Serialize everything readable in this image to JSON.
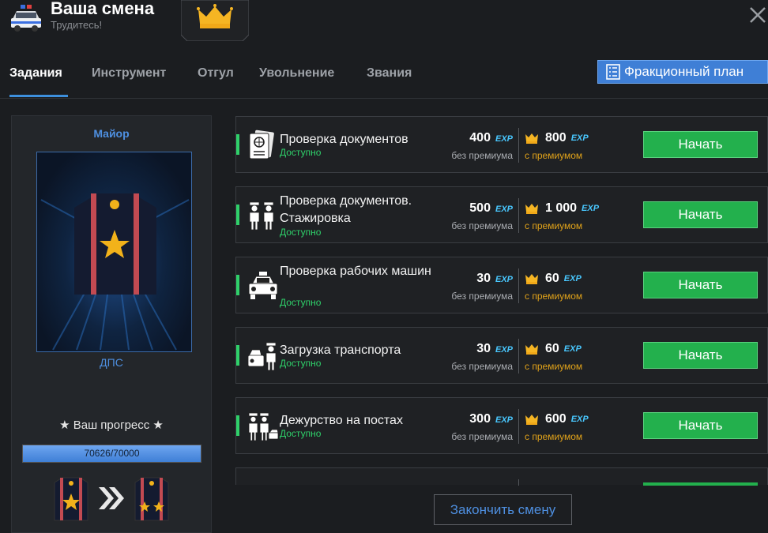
{
  "header": {
    "title": "Ваша смена",
    "subtitle": "Трудитесь!",
    "left_icon": "police-car-icon",
    "badge_icon": "crown-icon",
    "close_icon": "close-icon"
  },
  "tabs": [
    {
      "label": "Задания",
      "active": true
    },
    {
      "label": "Инструмент",
      "active": false
    },
    {
      "label": "Отгул",
      "active": false
    },
    {
      "label": "Увольнение",
      "active": false
    },
    {
      "label": "Звания",
      "active": false
    }
  ],
  "faction_plan_button": {
    "label": "Фракционный план",
    "icon": "document-list-icon"
  },
  "rank_panel": {
    "rank": "Майор",
    "department": "ДПС",
    "progress_label": "★ Ваш прогресс ★",
    "progress_text": "70626/70000",
    "progress_fraction": 1.0,
    "current_rank_icon": "epaulette-one-star-icon",
    "arrow_icon": "double-chevron-right-icon",
    "next_rank_icon": "epaulette-two-stars-icon"
  },
  "tasks": [
    {
      "name": "Проверка документов",
      "status": "Доступно",
      "base_value": "400",
      "base_note": "без премиума",
      "premium_value": "800",
      "premium_note": "с премиумом",
      "exp_label": "EXP",
      "button": "Начать",
      "icon": "passport-icon"
    },
    {
      "name": "Проверка документов. Стажировка",
      "status": "Доступно",
      "base_value": "500",
      "base_note": "без премиума",
      "premium_value": "1 000",
      "premium_note": "с премиумом",
      "exp_label": "EXP",
      "button": "Начать",
      "icon": "two-officers-icon"
    },
    {
      "name": "Проверка рабочих машин",
      "status": "Доступно",
      "base_value": "30",
      "base_note": "без премиума",
      "premium_value": "60",
      "premium_note": "с премиумом",
      "exp_label": "EXP",
      "button": "Начать",
      "icon": "police-car-front-icon"
    },
    {
      "name": "Загрузка транспорта",
      "status": "Доступно",
      "base_value": "30",
      "base_note": "без премиума",
      "premium_value": "60",
      "premium_note": "с премиумом",
      "exp_label": "EXP",
      "button": "Начать",
      "icon": "officer-with-car-icon"
    },
    {
      "name": "Дежурство на постах",
      "status": "Доступно",
      "base_value": "300",
      "base_note": "без премиума",
      "premium_value": "600",
      "premium_note": "с премиумом",
      "exp_label": "EXP",
      "button": "Начать",
      "icon": "officers-post-icon"
    }
  ],
  "end_shift_button": "Закончить смену",
  "colors": {
    "accent_blue": "#3f7fd6",
    "start_green": "#23b04d",
    "status_green": "#2fd06a",
    "exp_blue": "#49c8ff",
    "premium_gold": "#e0a21a"
  }
}
